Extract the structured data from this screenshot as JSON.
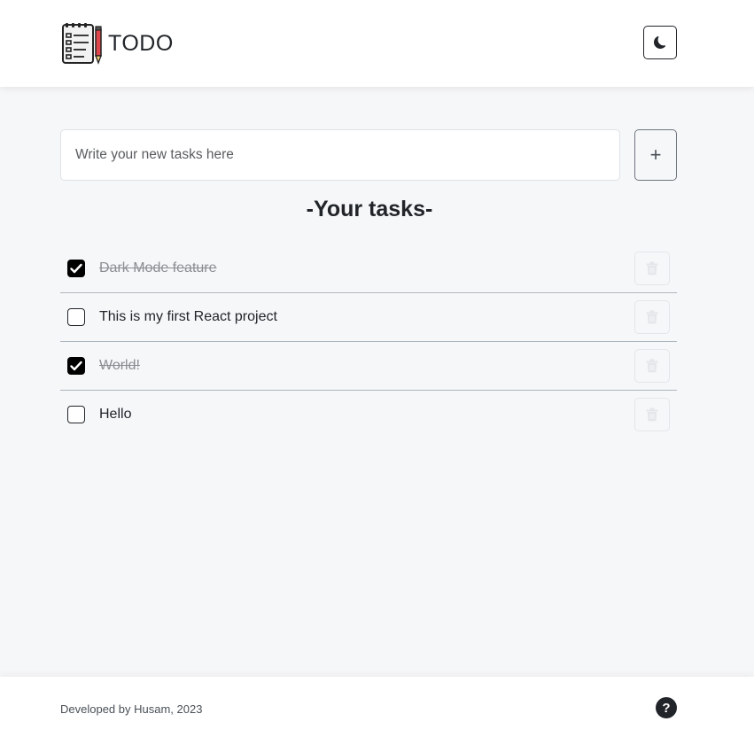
{
  "header": {
    "title": "TODO",
    "logo_icon": "notepad-pencil-icon",
    "theme_toggle_icon": "moon-icon"
  },
  "input": {
    "placeholder": "Write your new tasks here",
    "value": "",
    "add_label": "+"
  },
  "section_title": "-Your tasks-",
  "tasks": [
    {
      "text": "Dark Mode feature",
      "completed": true
    },
    {
      "text": "This is my first React project",
      "completed": false
    },
    {
      "text": "World!",
      "completed": true
    },
    {
      "text": "Hello",
      "completed": false
    }
  ],
  "footer": {
    "credit": "Developed by Husam, 2023",
    "help_icon": "question-circle-icon",
    "help_label": "?"
  },
  "colors": {
    "background": "#f6f7f9",
    "surface": "#ffffff",
    "text": "#212529",
    "checked": "#000000",
    "logo_pencil": "#e0474c"
  }
}
